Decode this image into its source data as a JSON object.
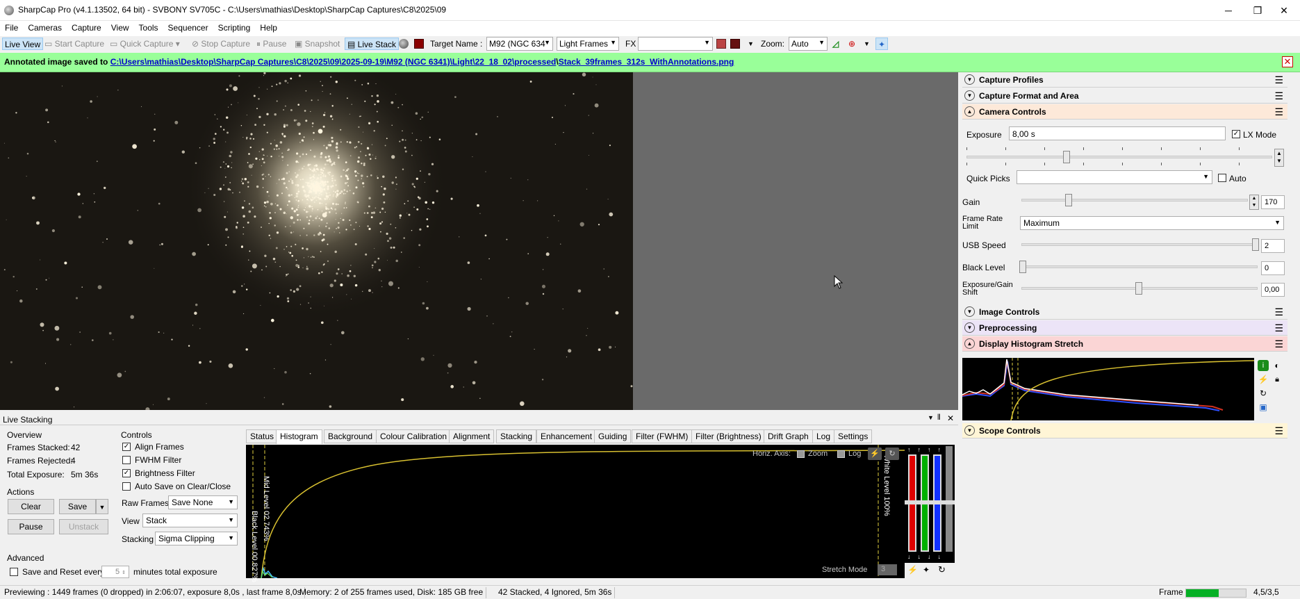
{
  "window": {
    "title": "SharpCap Pro (v4.1.13502, 64 bit) - SVBONY SV705C - C:\\Users\\mathias\\Desktop\\SharpCap Captures\\C8\\2025\\09"
  },
  "menu": [
    "File",
    "Cameras",
    "Capture",
    "View",
    "Tools",
    "Sequencer",
    "Scripting",
    "Help"
  ],
  "toolbar": {
    "live_view": "Live View",
    "start_capture": "Start Capture",
    "quick_capture": "Quick Capture",
    "stop_capture": "Stop Capture",
    "pause": "Pause",
    "snapshot": "Snapshot",
    "live_stack": "Live Stack",
    "target_name_label": "Target Name :",
    "target_name_value": "M92 (NGC 634",
    "frame_type": "Light Frames",
    "fx_label": "FX",
    "fx_value": "",
    "zoom_label": "Zoom:",
    "zoom_value": "Auto"
  },
  "notification": {
    "prefix": "Annotated image saved to",
    "path_dir": "C:\\Users\\mathias\\Desktop\\SharpCap Captures\\C8\\2025\\09\\2025-09-19\\M92 (NGC 6341)\\Light\\22_18_02\\processed",
    "path_sep": "\\",
    "path_file": "Stack_39frames_312s_WithAnnotations.png"
  },
  "right_panel": {
    "sections": {
      "capture_profiles": "Capture Profiles",
      "capture_format": "Capture Format and Area",
      "camera_controls": "Camera Controls",
      "image_controls": "Image Controls",
      "preprocessing": "Preprocessing",
      "display_histogram_stretch": "Display Histogram Stretch",
      "scope_controls": "Scope Controls"
    },
    "exposure_label": "Exposure",
    "exposure_value": "8,00 s",
    "lx_mode_label": "LX Mode",
    "quick_picks_label": "Quick Picks",
    "quick_picks_value": "",
    "auto_label": "Auto",
    "gain_label": "Gain",
    "gain_value": "170",
    "frame_rate_label_1": "Frame Rate",
    "frame_rate_label_2": "Limit",
    "frame_rate_value": "Maximum",
    "usb_speed_label": "USB Speed",
    "usb_speed_value": "2",
    "black_level_label": "Black Level",
    "black_level_value": "0",
    "exp_gain_shift_label_1": "Exposure/Gain",
    "exp_gain_shift_label_2": "Shift",
    "exp_gain_shift_value": "0,00"
  },
  "live_stacking": {
    "title": "Live Stacking",
    "overview_title": "Overview",
    "frames_stacked_label": "Frames Stacked:",
    "frames_stacked_value": "42",
    "frames_rejected_label": "Frames Rejected:",
    "frames_rejected_value": "4",
    "total_exposure_label": "Total Exposure:",
    "total_exposure_value": "5m 36s",
    "actions_title": "Actions",
    "clear": "Clear",
    "save": "Save",
    "pause": "Pause",
    "unstack": "Unstack",
    "advanced_title": "Advanced",
    "save_reset_label": "Save and Reset every",
    "save_reset_value": "5",
    "save_reset_suffix": "minutes total exposure",
    "controls_title": "Controls",
    "align_frames": "Align Frames",
    "fwhm_filter": "FWHM Filter",
    "brightness_filter": "Brightness Filter",
    "auto_save": "Auto Save on Clear/Close",
    "raw_frames_label": "Raw Frames",
    "raw_frames_value": "Save None",
    "view_label": "View",
    "view_value": "Stack",
    "stacking_label": "Stacking",
    "stacking_value": "Sigma Clipping",
    "tabs": [
      "Status",
      "Histogram",
      "Background",
      "Colour Calibration",
      "Alignment",
      "Stacking",
      "Enhancement",
      "Guiding",
      "Filter (FWHM)",
      "Filter (Brightness)",
      "Drift Graph",
      "Log",
      "Settings"
    ],
    "active_tab": "Histogram",
    "histogram": {
      "horiz_axis_label": "Horiz. Axis:",
      "zoom_label": "Zoom",
      "log_label": "Log",
      "mid_level": "Mid Level 02.743%",
      "black_level": "Black Level 00.827%",
      "white_level": "White Level 100%",
      "stretch_mode_label": "Stretch Mode",
      "stretch_mode_value": "3"
    }
  },
  "statusbar": {
    "previewing": "Previewing : 1449 frames (0 dropped) in 2:06:07, exposure 8,0s , last frame 8,0s",
    "memory": "Memory: 2 of 255 frames used, Disk: 185 GB free",
    "stacked": "42 Stacked, 4 Ignored, 5m 36s",
    "frame_label": "Frame :",
    "frame_ratio": "4,5/3,5"
  },
  "colors": {
    "notification_bg": "#99ff99",
    "camera_controls_header": "#fde9d9",
    "preprocessing_header": "#ece4f7",
    "histogram_stretch_header": "#fbd5d5",
    "scope_controls_header": "#fff5d6",
    "accent_blue": "#cce4f7"
  }
}
